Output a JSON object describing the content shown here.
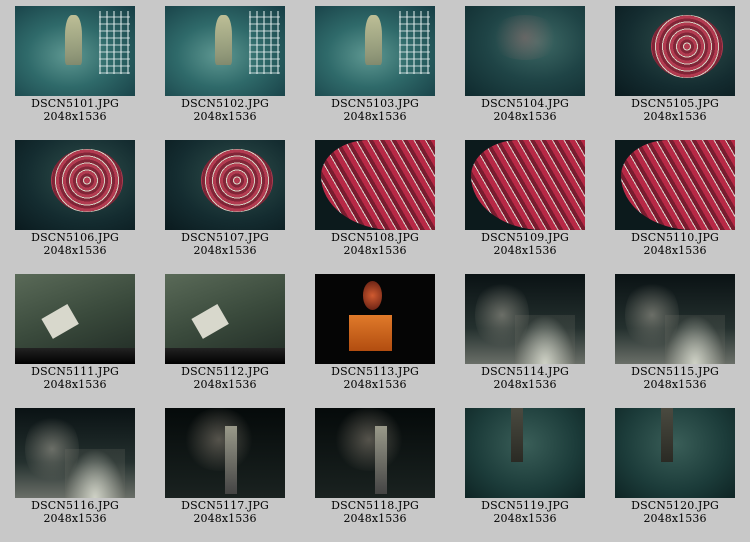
{
  "thumbnails": [
    {
      "filename": "DSCN5101.JPG",
      "dimensions": "2048x1536",
      "scene": "lab"
    },
    {
      "filename": "DSCN5102.JPG",
      "dimensions": "2048x1536",
      "scene": "lab"
    },
    {
      "filename": "DSCN5103.JPG",
      "dimensions": "2048x1536",
      "scene": "lab"
    },
    {
      "filename": "DSCN5104.JPG",
      "dimensions": "2048x1536",
      "scene": "dark"
    },
    {
      "filename": "DSCN5105.JPG",
      "dimensions": "2048x1536",
      "scene": "tubes"
    },
    {
      "filename": "DSCN5106.JPG",
      "dimensions": "2048x1536",
      "scene": "tubes"
    },
    {
      "filename": "DSCN5107.JPG",
      "dimensions": "2048x1536",
      "scene": "tubes"
    },
    {
      "filename": "DSCN5108.JPG",
      "dimensions": "2048x1536",
      "scene": "tubes-close"
    },
    {
      "filename": "DSCN5109.JPG",
      "dimensions": "2048x1536",
      "scene": "tubes-close"
    },
    {
      "filename": "DSCN5110.JPG",
      "dimensions": "2048x1536",
      "scene": "tubes-close"
    },
    {
      "filename": "DSCN5111.JPG",
      "dimensions": "2048x1536",
      "scene": "floor"
    },
    {
      "filename": "DSCN5112.JPG",
      "dimensions": "2048x1536",
      "scene": "floor"
    },
    {
      "filename": "DSCN5113.JPG",
      "dimensions": "2048x1536",
      "scene": "orange"
    },
    {
      "filename": "DSCN5114.JPG",
      "dimensions": "2048x1536",
      "scene": "smoke"
    },
    {
      "filename": "DSCN5115.JPG",
      "dimensions": "2048x1536",
      "scene": "smoke"
    },
    {
      "filename": "DSCN5116.JPG",
      "dimensions": "2048x1536",
      "scene": "smoke"
    },
    {
      "filename": "DSCN5117.JPG",
      "dimensions": "2048x1536",
      "scene": "smoke-dark"
    },
    {
      "filename": "DSCN5118.JPG",
      "dimensions": "2048x1536",
      "scene": "smoke-dark"
    },
    {
      "filename": "DSCN5119.JPG",
      "dimensions": "2048x1536",
      "scene": "teal"
    },
    {
      "filename": "DSCN5120.JPG",
      "dimensions": "2048x1536",
      "scene": "teal"
    }
  ]
}
